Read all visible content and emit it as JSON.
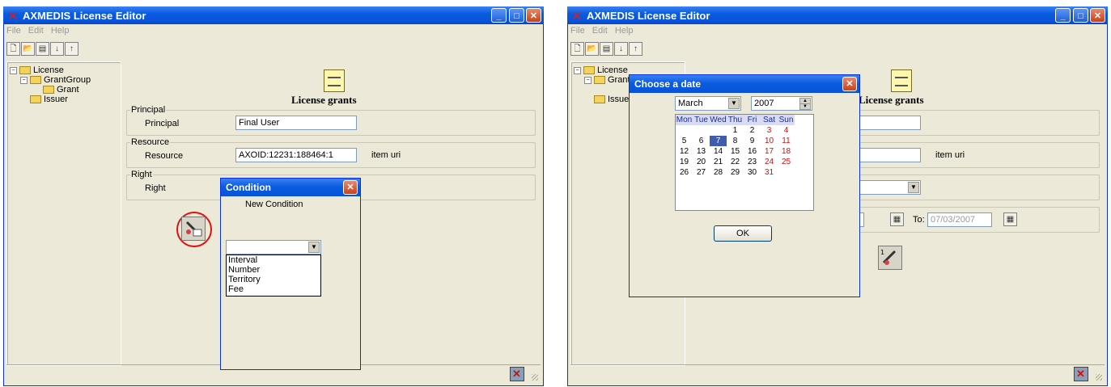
{
  "windows": {
    "left": {
      "title": "AXMEDIS License Editor",
      "menu": [
        "File",
        "Edit",
        "Help"
      ],
      "tree": [
        "License",
        "GrantGroup",
        "Grant",
        "Issuer"
      ],
      "header": "License grants",
      "principal": {
        "group": "Principal",
        "label": "Principal",
        "value": "Final User"
      },
      "resource": {
        "group": "Resource",
        "label": "Resource",
        "value": "AXOID:12231:188464:1",
        "note": "item uri"
      },
      "right": {
        "group": "Right",
        "label": "Right"
      },
      "condition_dialog": {
        "title": "Condition",
        "heading": "New Condition",
        "options": [
          "Interval",
          "Number",
          "Territory",
          "Fee"
        ]
      }
    },
    "right": {
      "title": "AXMEDIS License Editor",
      "menu": [
        "File",
        "Edit",
        "Help"
      ],
      "tree": [
        "License",
        "Grant",
        "Issuer"
      ],
      "header": "License grants",
      "resource_value": "8464:1",
      "resource_note": "item uri",
      "from_fragment": "7",
      "to_label": "To:",
      "to_value": "07/03/2007",
      "date_dialog": {
        "title": "Choose a date",
        "month": "March",
        "year": "2007",
        "weekdays": [
          "Mon",
          "Tue",
          "Wed",
          "Thu",
          "Fri",
          "Sat",
          "Sun"
        ],
        "weeks": [
          [
            "",
            "",
            "",
            "1",
            "2",
            "3",
            "4"
          ],
          [
            "5",
            "6",
            "7",
            "8",
            "9",
            "10",
            "11"
          ],
          [
            "12",
            "13",
            "14",
            "15",
            "16",
            "17",
            "18"
          ],
          [
            "19",
            "20",
            "21",
            "22",
            "23",
            "24",
            "25"
          ],
          [
            "26",
            "27",
            "28",
            "29",
            "30",
            "31",
            ""
          ]
        ],
        "selected_day": "7",
        "ok_label": "OK"
      }
    }
  },
  "colors": {
    "titlebar": "#0a5ce0",
    "window_bg": "#ECE9D8",
    "highlight": "#cc1111"
  }
}
